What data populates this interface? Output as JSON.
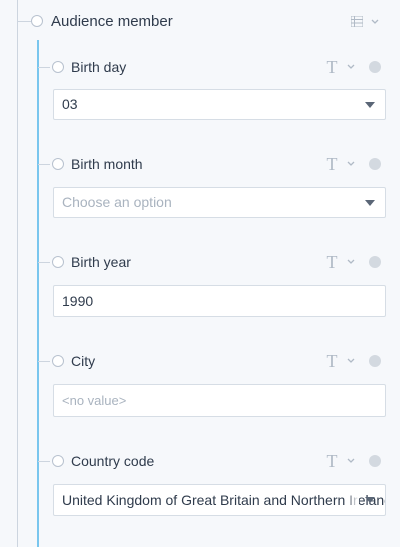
{
  "root": {
    "label": "Audience member"
  },
  "fields": [
    {
      "label": "Birth day",
      "kind": "select",
      "value": "03",
      "placeholder": ""
    },
    {
      "label": "Birth month",
      "kind": "select",
      "value": "",
      "placeholder": "Choose an option"
    },
    {
      "label": "Birth year",
      "kind": "text",
      "value": "1990",
      "placeholder": ""
    },
    {
      "label": "City",
      "kind": "text",
      "value": "",
      "placeholder": "<no value>"
    },
    {
      "label": "Country code",
      "kind": "select",
      "value": "United Kingdom of Great Britain and Northern Ireland",
      "placeholder": ""
    }
  ],
  "icons": {
    "type": "T",
    "root_action": "list-icon",
    "chevron": "chevron-down-icon",
    "info": "dot-icon"
  },
  "colors": {
    "tree_line": "#cdd5df",
    "active_branch": "#79c6ee",
    "icon": "#b0bac6"
  }
}
